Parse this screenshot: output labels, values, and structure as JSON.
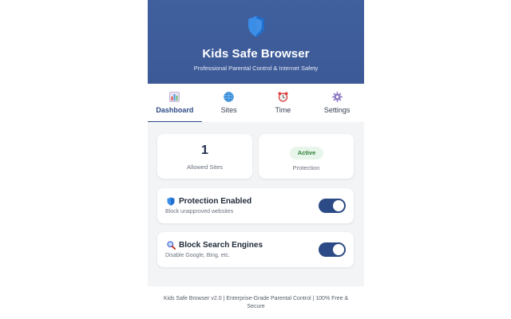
{
  "header": {
    "title": "Kids Safe Browser",
    "subtitle": "Professional Parental Control & Internet Safety"
  },
  "tabs": [
    {
      "label": "Dashboard",
      "icon": "bar-chart-icon",
      "active": true
    },
    {
      "label": "Sites",
      "icon": "globe-icon",
      "active": false
    },
    {
      "label": "Time",
      "icon": "alarm-clock-icon",
      "active": false
    },
    {
      "label": "Settings",
      "icon": "gear-icon",
      "active": false
    }
  ],
  "stats": {
    "allowed_sites_count": "1",
    "allowed_sites_label": "Allowed Sites",
    "protection_status": "Active",
    "protection_label": "Protection"
  },
  "toggles": [
    {
      "title": "Protection Enabled",
      "description": "Block unapproved websites",
      "icon": "shield-icon",
      "on": true
    },
    {
      "title": "Block Search Engines",
      "description": "Disable Google, Bing, etc.",
      "icon": "magnifier-icon",
      "on": true
    }
  ],
  "footer": {
    "line1": "Kids Safe Browser v2.0 | Enterprise-Grade Parental Control | 100% Free &",
    "line2": "Secure"
  },
  "colors": {
    "header_bg": "#3f5f9d",
    "accent": "#2c4a85",
    "badge_bg": "#e7f5ea",
    "badge_text": "#2e7d32",
    "panel_bg": "#f3f4f6"
  }
}
